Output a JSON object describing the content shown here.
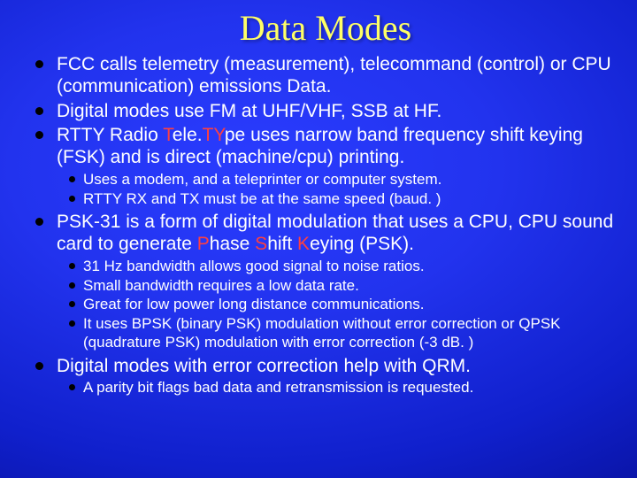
{
  "title": "Data Modes",
  "p1": {
    "b1a": "FCC calls telemetry (measurement), telecommand (control) or CPU (communication) emissions Data.",
    "b2a": "Digital modes use FM at UHF/VHF, SSB at HF.",
    "b3a": "RTTY Radio ",
    "b3red1": "T",
    "b3b": "ele.",
    "b3red2": "TY",
    "b3c": "pe uses narrow band frequency shift keying (FSK) and is direct (machine/cpu) printing.",
    "b3s1": "Uses a modem, and a teleprinter or computer system.",
    "b3s2": "RTTY RX and TX must be at the same speed (baud. )",
    "b4a": "PSK-31 is a form of digital modulation that uses a CPU, CPU sound card to generate ",
    "b4red1": "P",
    "b4b": "hase ",
    "b4red2": "S",
    "b4c": "hift ",
    "b4red3": "K",
    "b4d": "eying (PSK).",
    "b4s1": "31 Hz bandwidth allows good signal to noise ratios.",
    "b4s2": "Small bandwidth requires a low data rate.",
    "b4s3": "Great for low power long distance communications.",
    "b4s4": "It uses BPSK (binary PSK) modulation without error correction or QPSK (quadrature PSK) modulation with error correction (-3 dB. )",
    "b5a": "Digital modes with error correction help with QRM.",
    "b5s1": "A parity bit flags bad data and retransmission is requested."
  }
}
